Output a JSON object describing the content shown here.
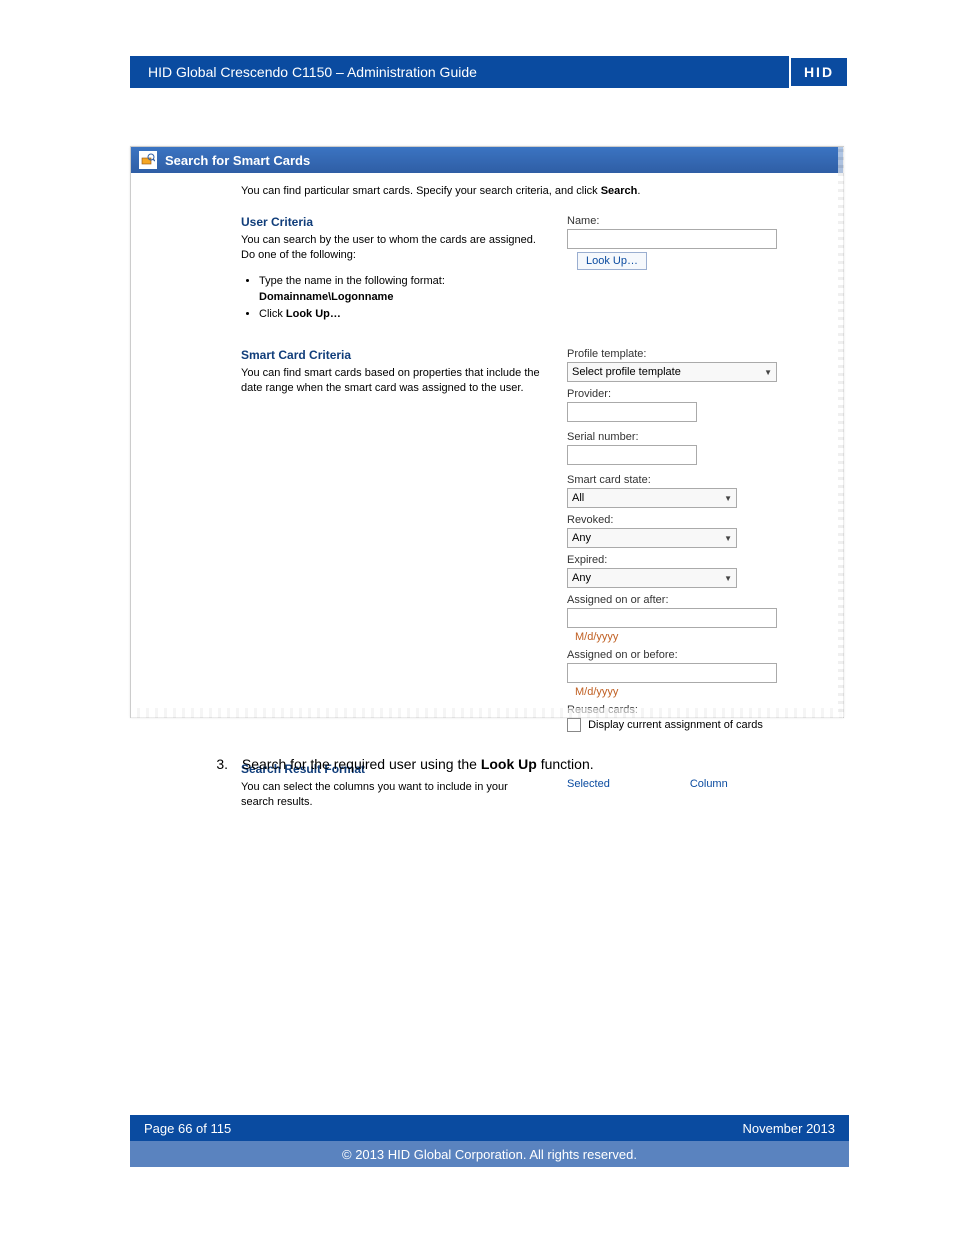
{
  "header": {
    "title": "HID Global Crescendo C1150  – Administration Guide",
    "logo": "HID"
  },
  "screenshot": {
    "title": "Search for Smart Cards",
    "intro_prefix": "You can find particular smart cards. Specify your search criteria, and click ",
    "intro_bold": "Search",
    "intro_suffix": ".",
    "user_criteria": {
      "heading": "User Criteria",
      "desc": "You can search by the user to whom the cards are assigned. Do one of the following:",
      "bullet1_prefix": "Type the name in the following format:",
      "bullet1_bold": "Domainname\\Logonname",
      "bullet2_prefix": "Click ",
      "bullet2_bold": "Look Up…",
      "name_label": "Name:",
      "lookup_label": "Look Up…"
    },
    "smart_card_criteria": {
      "heading": "Smart Card Criteria",
      "desc": "You can find smart cards based on properties that include the date range when the smart card was assigned to the user.",
      "fields": {
        "profile_template_label": "Profile template:",
        "profile_template_value": "Select profile template",
        "provider_label": "Provider:",
        "serial_label": "Serial number:",
        "state_label": "Smart card state:",
        "state_value": "All",
        "revoked_label": "Revoked:",
        "revoked_value": "Any",
        "expired_label": "Expired:",
        "expired_value": "Any",
        "assigned_after_label": "Assigned on or after:",
        "assigned_before_label": "Assigned on or before:",
        "date_hint": "M/d/yyyy",
        "reused_label": "Reused cards:",
        "reused_checkbox_label": "Display current assignment of cards"
      }
    },
    "result_format": {
      "heading": "Search Result Format",
      "desc": "You can select the columns you want to include in your search results.",
      "col_selected": "Selected",
      "col_column": "Column"
    }
  },
  "step": {
    "number": "3.",
    "text_prefix": "Search for the required user using the ",
    "text_bold": "Look Up",
    "text_suffix": " function."
  },
  "footer": {
    "page": "Page 66 of 115",
    "date": "November 2013",
    "copyright": "© 2013 HID Global Corporation. All rights reserved."
  }
}
